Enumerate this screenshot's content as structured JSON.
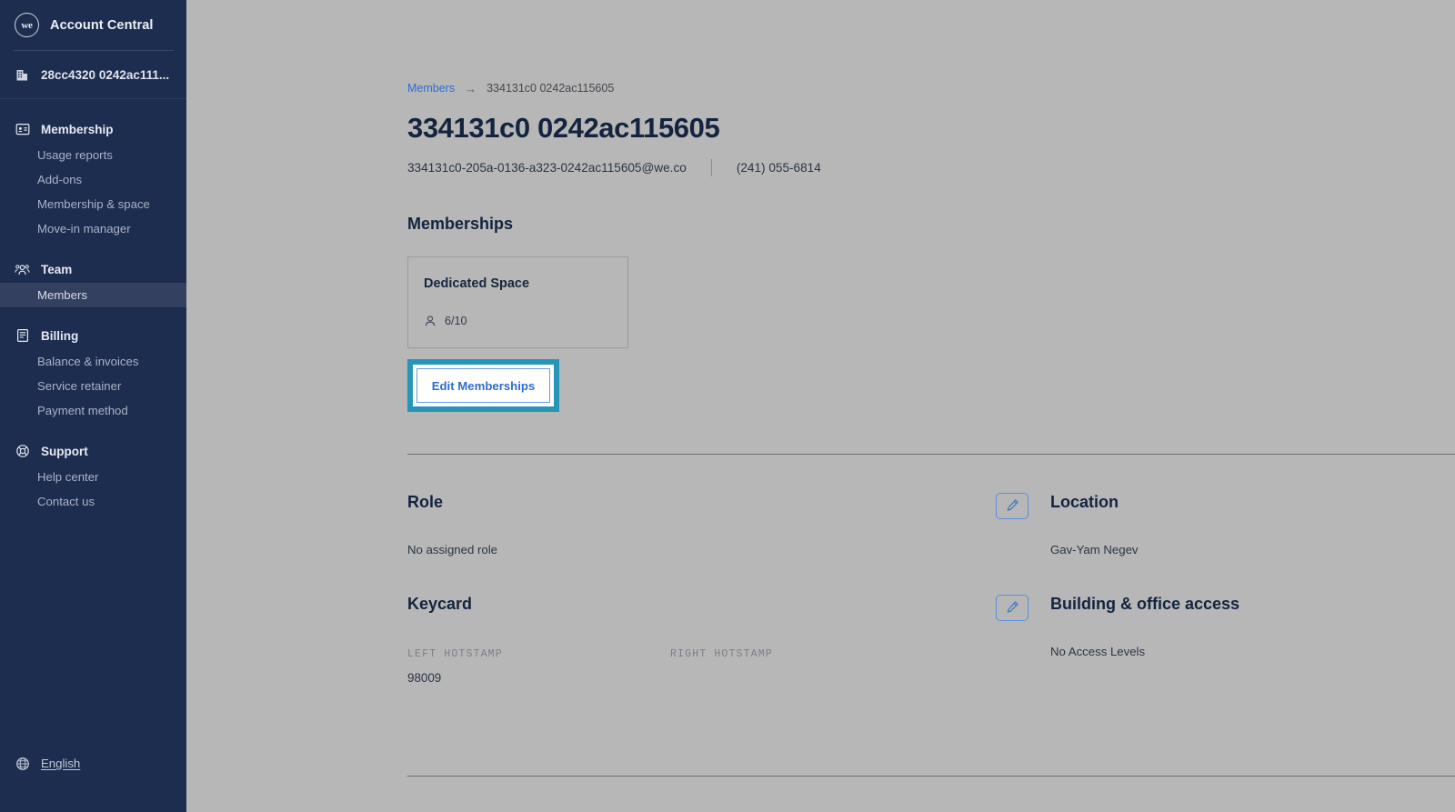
{
  "sidebar": {
    "brand": {
      "logo_text": "we",
      "logo_icon": "we-circle-logo",
      "title": "Account Central"
    },
    "org": {
      "icon": "building-icon",
      "name": "28cc4320 0242ac111..."
    },
    "groups": [
      {
        "icon": "membership-card-icon",
        "label": "Membership",
        "items": [
          {
            "label": "Usage reports",
            "active": false
          },
          {
            "label": "Add-ons",
            "active": false
          },
          {
            "label": "Membership & space",
            "active": false
          },
          {
            "label": "Move-in manager",
            "active": false
          }
        ]
      },
      {
        "icon": "team-people-icon",
        "label": "Team",
        "items": [
          {
            "label": "Members",
            "active": true
          }
        ]
      },
      {
        "icon": "billing-invoice-icon",
        "label": "Billing",
        "items": [
          {
            "label": "Balance & invoices",
            "active": false
          },
          {
            "label": "Service retainer",
            "active": false
          },
          {
            "label": "Payment method",
            "active": false
          }
        ]
      },
      {
        "icon": "support-lifebuoy-icon",
        "label": "Support",
        "items": [
          {
            "label": "Help center",
            "active": false
          },
          {
            "label": "Contact us",
            "active": false
          }
        ]
      }
    ],
    "language": {
      "icon": "globe-icon",
      "label": "English"
    }
  },
  "header": {
    "avatar_icon": "user-avatar-gradient",
    "breadcrumb": {
      "parent": "Members",
      "arrow": "→",
      "current": "334131c0 0242ac115605"
    },
    "title": "334131c0 0242ac115605",
    "email": "334131c0-205a-0136-a323-0242ac115605@we.co",
    "phone": "(241) 055-6814"
  },
  "memberships": {
    "section_title": "Memberships",
    "cards": [
      {
        "title": "Dedicated Space",
        "seats_icon": "person-icon",
        "seats": "6/10"
      }
    ],
    "edit_button_label": "Edit Memberships",
    "edit_button_highlight_color": "#2596b8"
  },
  "details": {
    "role": {
      "title": "Role",
      "value": "No assigned role",
      "edit_icon": "pencil-icon"
    },
    "location": {
      "title": "Location",
      "value": "Gav-Yam Negev",
      "edit_icon": "pencil-icon"
    },
    "keycard": {
      "title": "Keycard",
      "edit_icon": "pencil-icon",
      "left_label": "LEFT HOTSTAMP",
      "left_value": "98009",
      "right_label": "RIGHT HOTSTAMP",
      "right_value": ""
    },
    "access": {
      "title": "Building & office access",
      "value": "No Access Levels",
      "edit_icon": "pencil-icon"
    }
  },
  "colors": {
    "sidebar_bg": "#1d2d50",
    "page_bg": "#b7b7b7",
    "link_blue": "#2d6dd2",
    "highlight_teal": "#2596b8",
    "text_dark": "#14243f"
  }
}
